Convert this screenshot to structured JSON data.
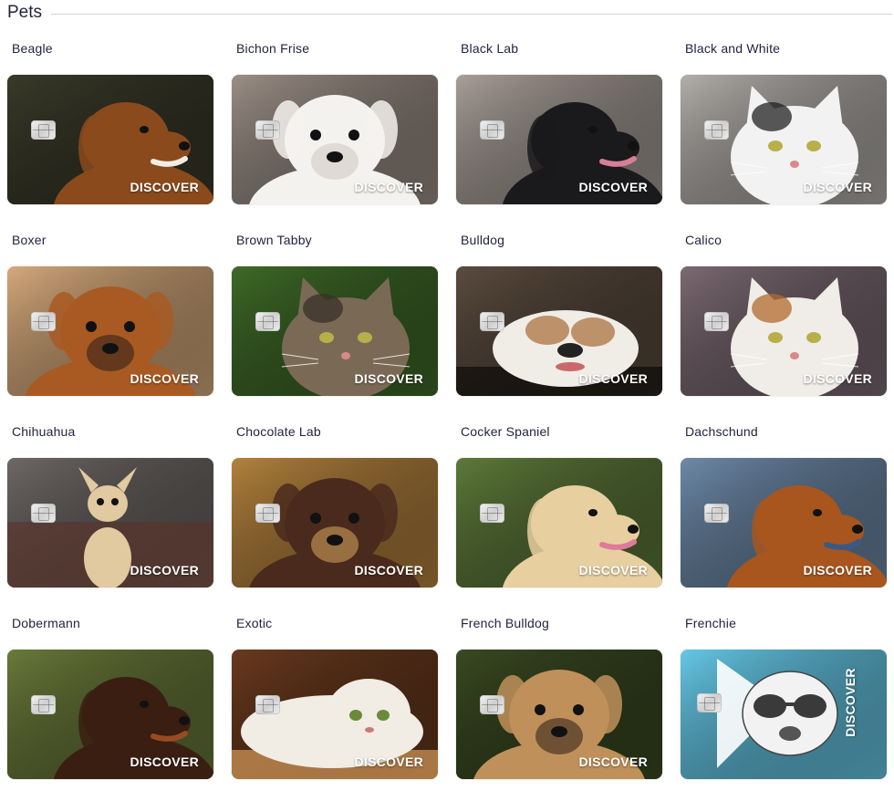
{
  "section": {
    "title": "Pets"
  },
  "cards": [
    {
      "label": "Beagle",
      "brand": "DISCOVER",
      "bg": "#3a3a2a",
      "fg": "#8a4a1c",
      "accent": "#f1ece4",
      "pose": "dog-side"
    },
    {
      "label": "Bichon Frise",
      "brand": "DISCOVER",
      "bg": "#9b8f86",
      "fg": "#f4f2ee",
      "accent": "#cfc7bf",
      "pose": "dog-front"
    },
    {
      "label": "Black Lab",
      "brand": "DISCOVER",
      "bg": "#a89f98",
      "fg": "#1a1a1c",
      "accent": "#d77f96",
      "pose": "dog-side"
    },
    {
      "label": "Black and White",
      "brand": "DISCOVER",
      "bg": "#b3afab",
      "fg": "#f2f2f2",
      "accent": "#222222",
      "pose": "cat"
    },
    {
      "label": "Boxer",
      "brand": "DISCOVER",
      "bg": "#d6aa7c",
      "fg": "#a85a22",
      "accent": "#2a1e18",
      "pose": "dog-front"
    },
    {
      "label": "Brown Tabby",
      "brand": "DISCOVER",
      "bg": "#3f6a28",
      "fg": "#7a6a55",
      "accent": "#3a3028",
      "pose": "cat"
    },
    {
      "label": "Bulldog",
      "brand": "DISCOVER",
      "bg": "#5b4c3f",
      "fg": "#f0ece6",
      "accent": "#b07a4a",
      "pose": "dog-lying"
    },
    {
      "label": "Calico",
      "brand": "DISCOVER",
      "bg": "#7b6a72",
      "fg": "#f0ede8",
      "accent": "#b2692c",
      "pose": "cat"
    },
    {
      "label": "Chihuahua",
      "brand": "DISCOVER",
      "bg": "#6e6866",
      "fg": "#e1c9a0",
      "accent": "#5a3226",
      "pose": "dog-sit"
    },
    {
      "label": "Chocolate Lab",
      "brand": "DISCOVER",
      "bg": "#b4823e",
      "fg": "#4a2a1c",
      "accent": "#d9a860",
      "pose": "dog-front"
    },
    {
      "label": "Cocker Spaniel",
      "brand": "DISCOVER",
      "bg": "#5e7a3a",
      "fg": "#e8cfa0",
      "accent": "#e07a9a",
      "pose": "dog-side"
    },
    {
      "label": "Dachschund",
      "brand": "DISCOVER",
      "bg": "#6e8aa8",
      "fg": "#a8561e",
      "accent": "#3a5a86",
      "pose": "dog-side"
    },
    {
      "label": "Dobermann",
      "brand": "DISCOVER",
      "bg": "#6a7a3a",
      "fg": "#3a1e12",
      "accent": "#9a4a22",
      "pose": "dog-side"
    },
    {
      "label": "Exotic",
      "brand": "DISCOVER",
      "bg": "#6a3a1e",
      "fg": "#f1ece4",
      "accent": "#d49a5a",
      "pose": "cat-lying"
    },
    {
      "label": "French Bulldog",
      "brand": "DISCOVER",
      "bg": "#3a4a22",
      "fg": "#c0905a",
      "accent": "#2a1e18",
      "pose": "dog-front"
    },
    {
      "label": "Frenchie",
      "brand": "DISCOVER",
      "bg": "#66c9e8",
      "fg": "#f2f2f2",
      "accent": "#3a3a3a",
      "pose": "frenchie",
      "vertical": true
    }
  ]
}
